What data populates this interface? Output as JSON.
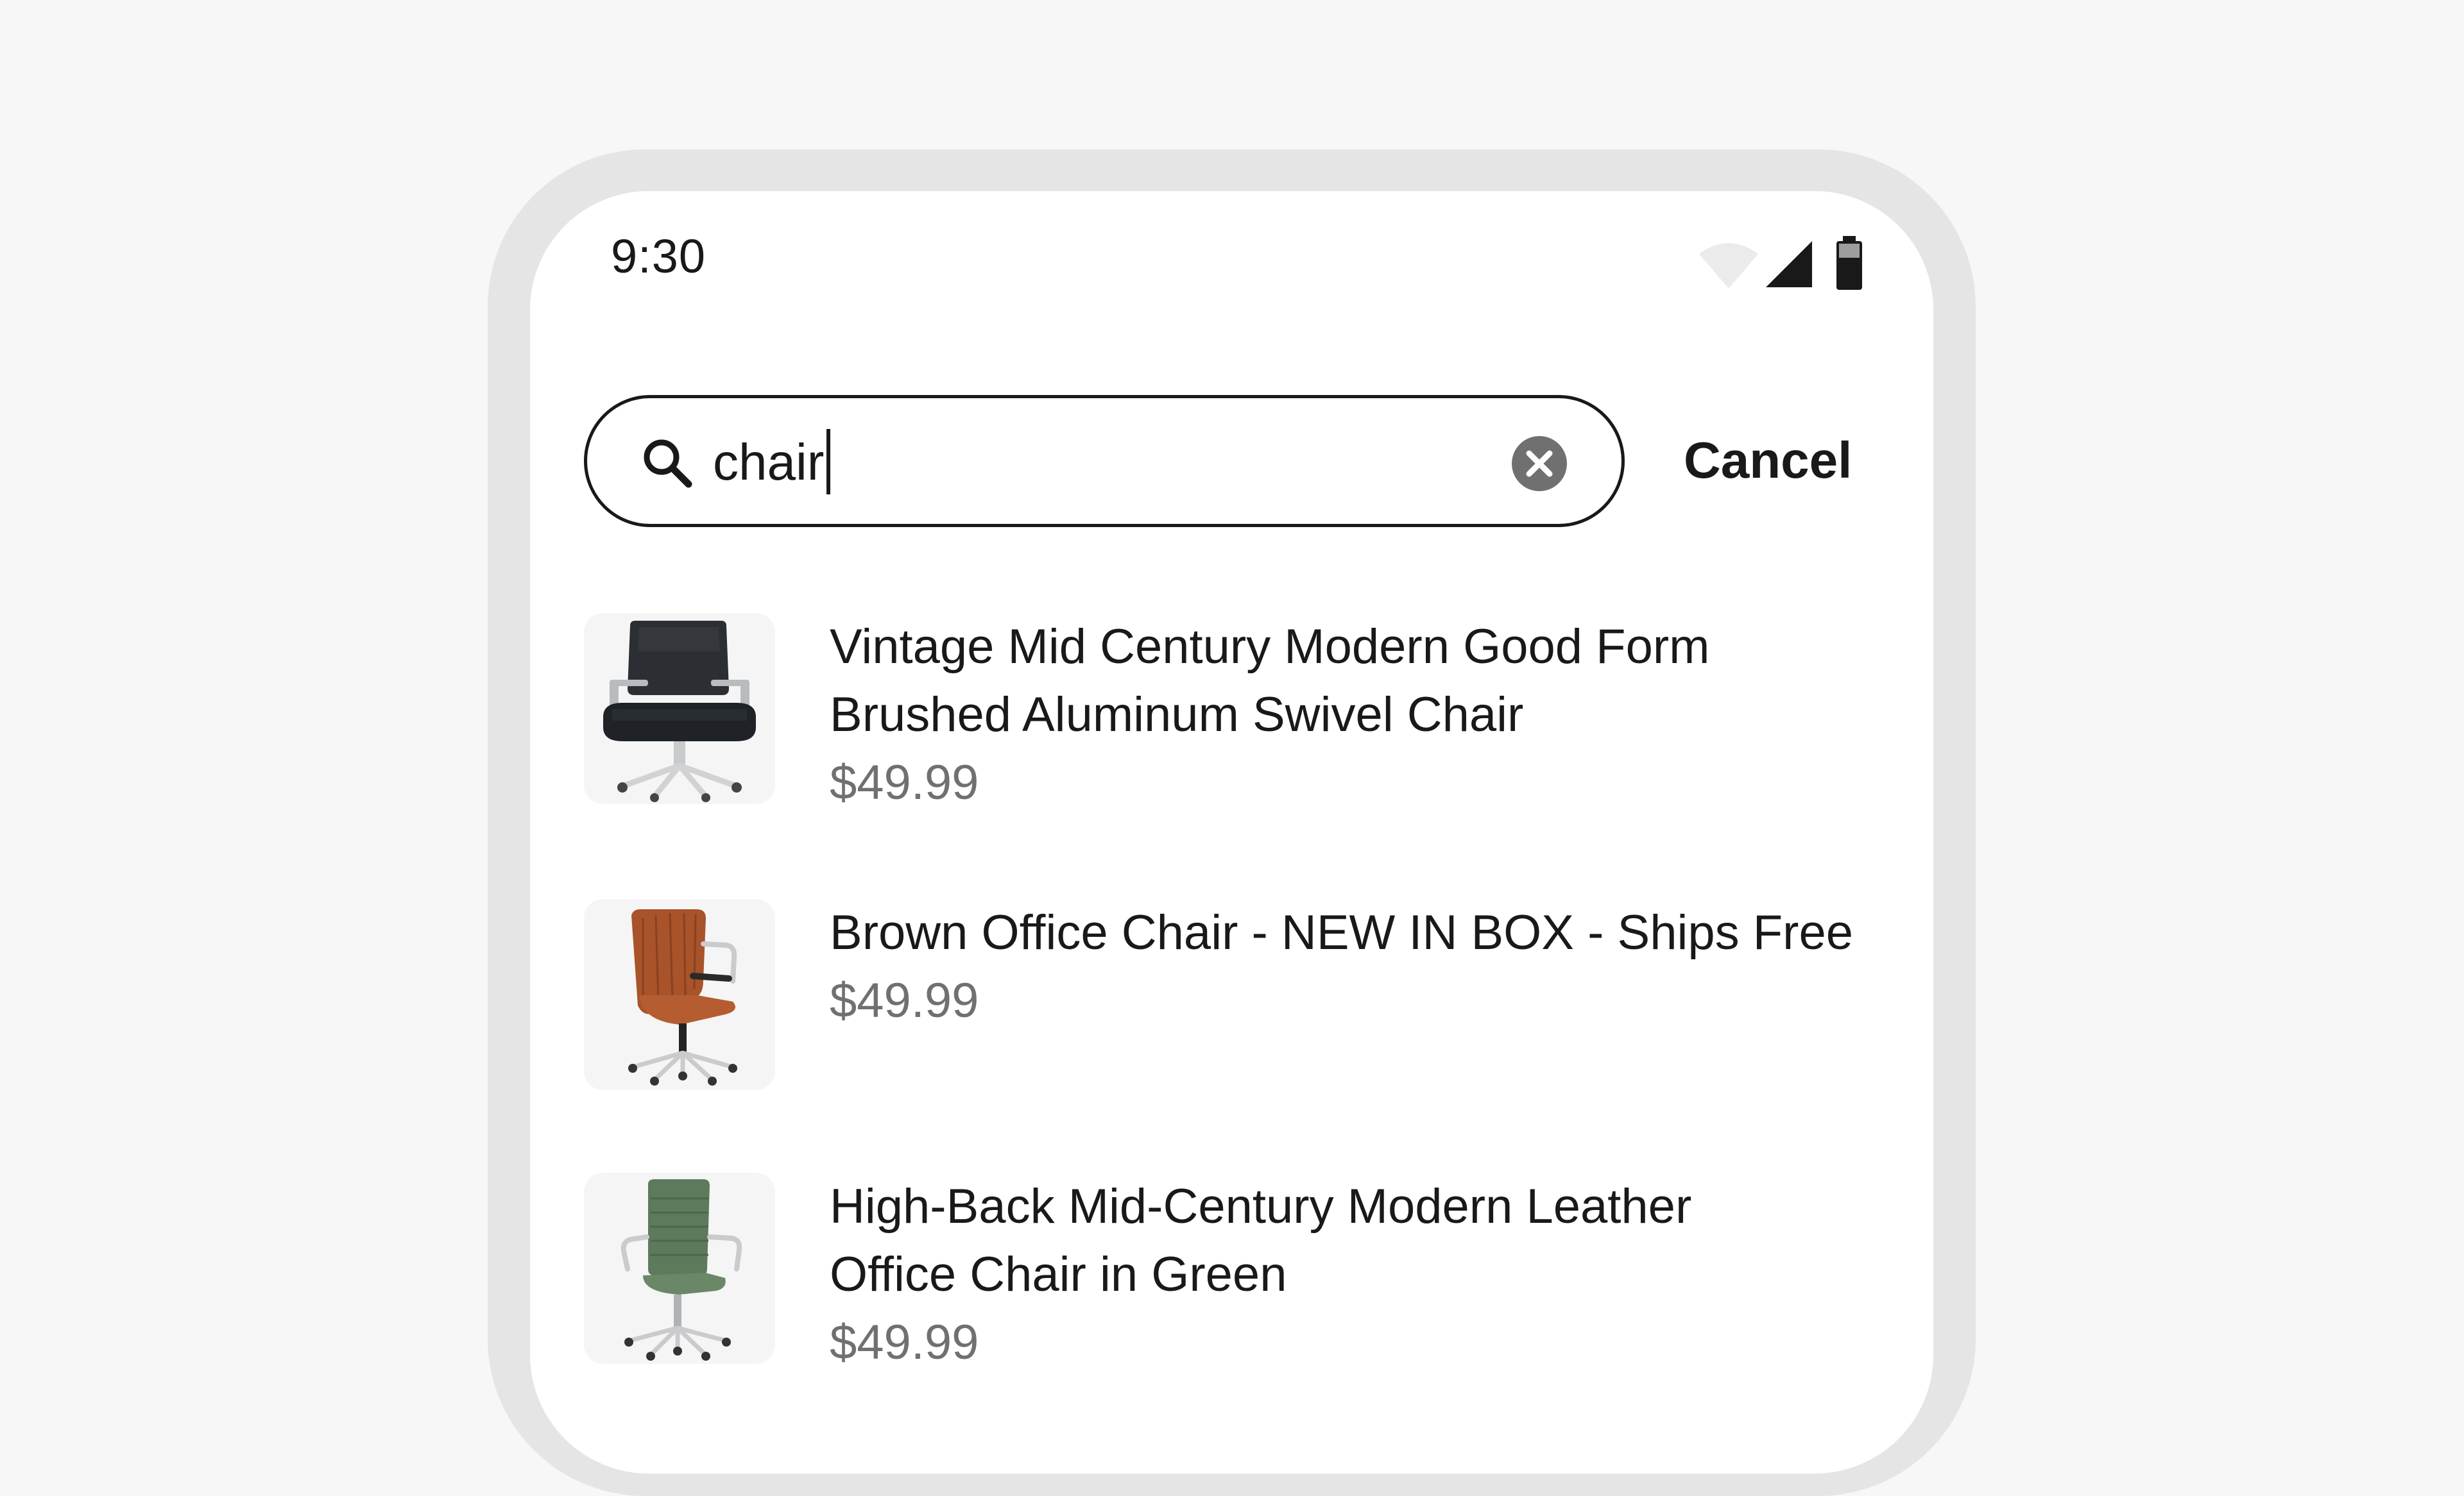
{
  "status_bar": {
    "time": "9:30",
    "icons": [
      "wifi-icon",
      "cellular-signal-icon",
      "battery-icon"
    ]
  },
  "search": {
    "query": "chair",
    "placeholder": "",
    "cancel_label": "Cancel"
  },
  "results": [
    {
      "title_line1": "Vintage Mid Century Modern Good Form",
      "title_line2": "Brushed Aluminum Swivel Chair",
      "price": "$49.99",
      "image": "black-office-chair"
    },
    {
      "title_line1": "Brown Office Chair - NEW IN BOX - Ships Free",
      "price": "$49.99",
      "image": "brown-office-chair"
    },
    {
      "title_line1": "High-Back Mid-Century Modern Leather",
      "title_line2": "Office Chair in Green",
      "price": "$49.99",
      "image": "green-office-chair"
    }
  ],
  "colors": {
    "background": "#f7f7f7",
    "frame": "#e5e5e5",
    "screen": "#ffffff",
    "text": "#191919",
    "price": "#707070",
    "clear_icon": "#707070",
    "thumb_bg": "#f5f5f5"
  }
}
